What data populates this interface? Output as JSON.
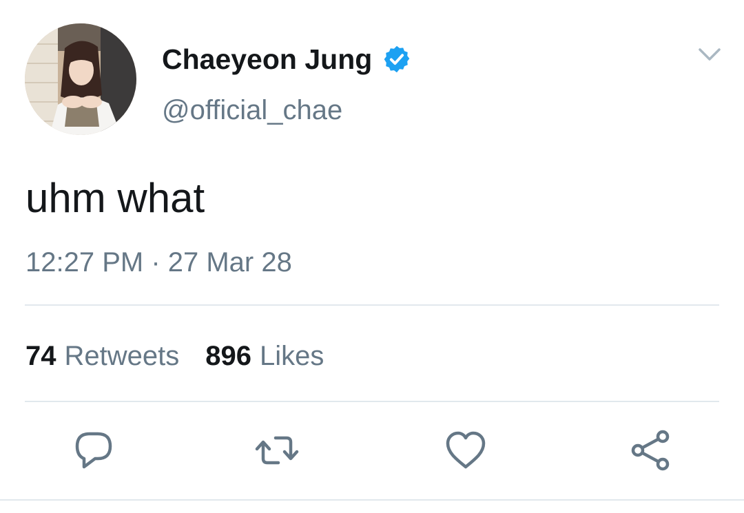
{
  "tweet": {
    "author": {
      "display_name": "Chaeyeon Jung",
      "handle": "@official_chae",
      "verified": true,
      "avatar_icon": "profile-photo"
    },
    "text": "uhm what",
    "timestamp": "12:27 PM · 27 Mar 28",
    "stats": {
      "retweets_count": "74",
      "retweets_label": "Retweets",
      "likes_count": "896",
      "likes_label": "Likes"
    },
    "actions": [
      {
        "icon": "reply-icon"
      },
      {
        "icon": "retweet-icon"
      },
      {
        "icon": "like-icon"
      },
      {
        "icon": "share-icon"
      }
    ],
    "menu_icon": "chevron-down-icon"
  },
  "colors": {
    "primary_text": "#14171a",
    "secondary_text": "#657786",
    "divider": "#e1e8ed",
    "verified_blue": "#1da1f2"
  }
}
